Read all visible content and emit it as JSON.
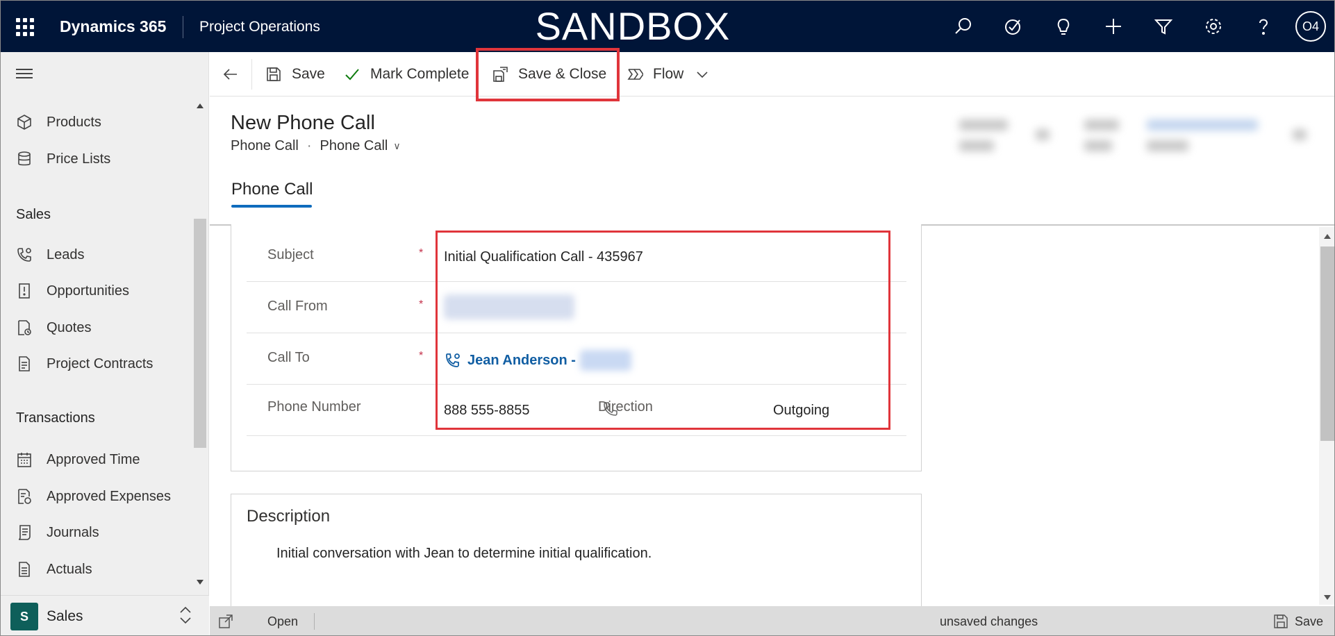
{
  "topbar": {
    "brand": "Dynamics 365",
    "app_name": "Project Operations",
    "environment_label": "SANDBOX",
    "avatar_initials": "O4",
    "background": "#001538",
    "icons": [
      "search-icon",
      "task-check-icon",
      "lightbulb-icon",
      "plus-icon",
      "filter-icon",
      "gear-icon",
      "help-icon"
    ]
  },
  "sidebar": {
    "items_top": [
      {
        "label": "Products",
        "icon": "cube-icon"
      },
      {
        "label": "Price Lists",
        "icon": "stack-icon"
      }
    ],
    "groups": [
      {
        "title": "Sales",
        "items": [
          {
            "label": "Leads",
            "icon": "phone-gear-icon"
          },
          {
            "label": "Opportunities",
            "icon": "opportunity-icon"
          },
          {
            "label": "Quotes",
            "icon": "quote-icon"
          },
          {
            "label": "Project Contracts",
            "icon": "contract-icon"
          }
        ]
      },
      {
        "title": "Transactions",
        "items": [
          {
            "label": "Approved Time",
            "icon": "calendar-icon"
          },
          {
            "label": "Approved Expenses",
            "icon": "expense-icon"
          },
          {
            "label": "Journals",
            "icon": "journal-icon"
          },
          {
            "label": "Actuals",
            "icon": "document-icon"
          }
        ]
      }
    ],
    "area": {
      "badge": "S",
      "name": "Sales",
      "badge_color": "#0e5f5a"
    }
  },
  "commandbar": {
    "save": "Save",
    "mark_complete": "Mark Complete",
    "save_close": "Save & Close",
    "flow": "Flow"
  },
  "record": {
    "title": "New Phone Call",
    "entity": "Phone Call",
    "form_selector": "Phone Call",
    "tab": "Phone Call"
  },
  "form": {
    "subject_label": "Subject",
    "subject_value": "Initial Qualification Call - 435967",
    "call_from_label": "Call From",
    "call_to_label": "Call To",
    "call_to_value": "Jean Anderson -",
    "phone_label": "Phone Number",
    "phone_value": "888 555-8855",
    "direction_label": "Direction",
    "direction_value": "Outgoing",
    "required_marker": "*"
  },
  "description": {
    "label": "Description",
    "text": "Initial conversation with Jean to determine initial qualification."
  },
  "footer": {
    "open": "Open",
    "status": "unsaved changes",
    "save": "Save"
  },
  "colors": {
    "highlight": "#e0353b",
    "link": "#115ea3",
    "tab_underline": "#0f6cbd",
    "required": "#c4314b"
  }
}
